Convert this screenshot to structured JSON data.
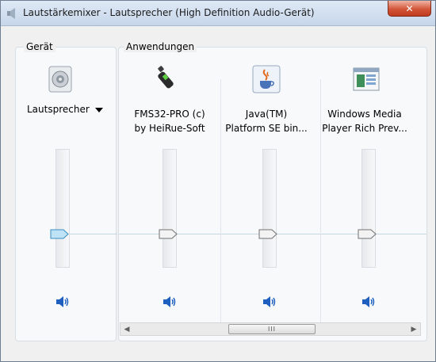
{
  "window": {
    "title": "Lautstärkemixer - Lautsprecher (High Definition Audio-Gerät)",
    "close_label": "✕"
  },
  "device_group": {
    "label": "Gerät",
    "device_name": "Lautsprecher",
    "slider_level": 0.5,
    "speaker_icon": "speaker-icon"
  },
  "apps_group": {
    "label": "Anwendungen",
    "apps": [
      {
        "name_line1": "FMS32-PRO (c)",
        "name_line2": "by HeiRue-Soft",
        "icon": "radio-mic-icon",
        "slider_level": 0.5
      },
      {
        "name_line1": "Java(TM)",
        "name_line2": "Platform SE bin...",
        "icon": "java-icon",
        "slider_level": 0.5
      },
      {
        "name_line1": "Windows Media",
        "name_line2": "Player Rich Prev...",
        "icon": "media-player-icon",
        "slider_level": 0.5
      }
    ]
  },
  "scrollbar": {
    "left_arrow": "◀",
    "right_arrow": "▶",
    "grip": "III"
  }
}
